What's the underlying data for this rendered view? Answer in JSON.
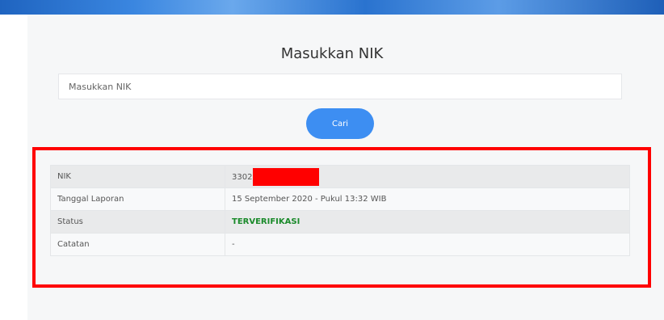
{
  "page": {
    "title": "Masukkan NIK"
  },
  "search": {
    "placeholder": "Masukkan NIK",
    "value": "",
    "button_label": "Cari"
  },
  "result": {
    "rows": [
      {
        "label": "NIK",
        "value": "3302"
      },
      {
        "label": "Tanggal Laporan",
        "value": "15 September 2020 - Pukul 13:32 WIB"
      },
      {
        "label": "Status",
        "value": "TERVERIFIKASI"
      },
      {
        "label": "Catatan",
        "value": "-"
      }
    ]
  },
  "colors": {
    "accent": "#3d8ef2",
    "status_verified": "#1a8a2a",
    "highlight": "#ff0000",
    "redaction": "#ff0000"
  }
}
